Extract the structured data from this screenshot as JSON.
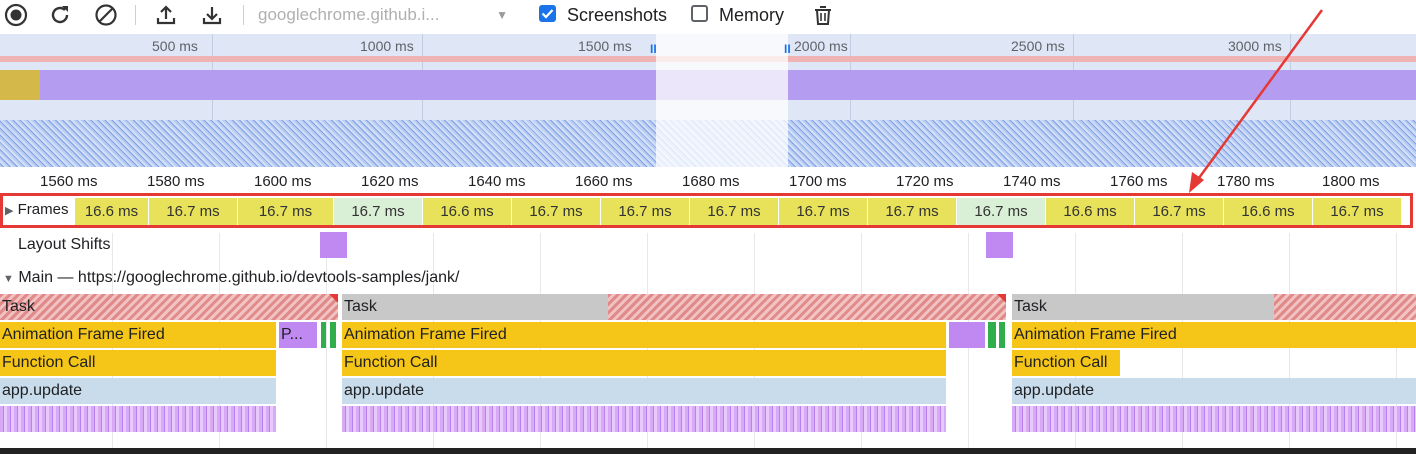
{
  "toolbar": {
    "record_icon": "record-icon",
    "reload_icon": "reload-icon",
    "clear_icon": "clear-icon",
    "upload_icon": "upload-icon",
    "download_icon": "download-icon",
    "url_value": "googlechrome.github.i...",
    "screenshots_label": "Screenshots",
    "screenshots_checked": true,
    "memory_label": "Memory",
    "memory_checked": false,
    "trash_icon": "trash-icon"
  },
  "overview": {
    "ticks": [
      "500 ms",
      "1000 ms",
      "1500 ms",
      "2000 ms",
      "2500 ms",
      "3000 ms"
    ]
  },
  "ruler": {
    "ticks": [
      "1560 ms",
      "1580 ms",
      "1600 ms",
      "1620 ms",
      "1640 ms",
      "1660 ms",
      "1680 ms",
      "1700 ms",
      "1720 ms",
      "1740 ms",
      "1760 ms",
      "1780 ms",
      "1800 ms"
    ]
  },
  "frames": {
    "label": "Frames",
    "items": [
      "16.6 ms",
      "16.7 ms",
      "16.7 ms",
      "16.7 ms",
      "16.6 ms",
      "16.7 ms",
      "16.7 ms",
      "16.7 ms",
      "16.7 ms",
      "16.7 ms",
      "16.7 ms",
      "16.6 ms",
      "16.7 ms",
      "16.6 ms",
      "16.7 ms"
    ]
  },
  "layout_shifts": {
    "label": "Layout Shifts"
  },
  "main": {
    "label": "Main — https://googlechrome.github.io/devtools-samples/jank/",
    "task_label": "Task",
    "animation_label": "Animation Frame Fired",
    "function_label": "Function Call",
    "update_label": "app.update",
    "paint_short": "P..."
  },
  "colors": {
    "annotation_red": "#e53935",
    "frame_yellow": "#e8e25a",
    "frame_green": "#d9efd6",
    "scripting_yellow": "#f5c518"
  }
}
